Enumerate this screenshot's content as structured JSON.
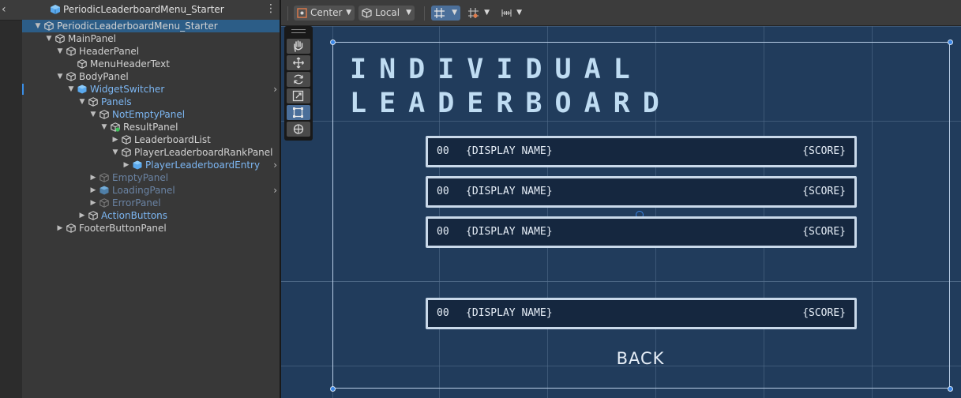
{
  "hierarchy": {
    "title": "PeriodicLeaderboardMenu_Starter",
    "back_glyph": "‹",
    "menu_glyph": "⋮",
    "rows": [
      {
        "label": "PeriodicLeaderboardMenu_Starter",
        "arrow": "▼",
        "selected": true
      },
      {
        "label": "MainPanel",
        "arrow": "▼"
      },
      {
        "label": "HeaderPanel",
        "arrow": "▼"
      },
      {
        "label": "MenuHeaderText",
        "arrow": ""
      },
      {
        "label": "BodyPanel",
        "arrow": "▼"
      },
      {
        "label": "WidgetSwitcher",
        "arrow": "▼",
        "prefab": true,
        "chevron": "›"
      },
      {
        "label": "Panels",
        "arrow": "▼",
        "prefab_child": true
      },
      {
        "label": "NotEmptyPanel",
        "arrow": "▼",
        "prefab_child": true
      },
      {
        "label": "ResultPanel",
        "arrow": "▼"
      },
      {
        "label": "LeaderboardList",
        "arrow": "▶"
      },
      {
        "label": "PlayerLeaderboardRankPanel",
        "arrow": "▼"
      },
      {
        "label": "PlayerLeaderboardEntry",
        "arrow": "▶",
        "prefab": true,
        "chevron": "›"
      },
      {
        "label": "EmptyPanel",
        "arrow": "▶",
        "inactive": true
      },
      {
        "label": "LoadingPanel",
        "arrow": "▶",
        "inactive": true,
        "prefab": true,
        "chevron": "›"
      },
      {
        "label": "ErrorPanel",
        "arrow": "▶",
        "inactive": true
      },
      {
        "label": "ActionButtons",
        "arrow": "▶",
        "prefab_child": true
      },
      {
        "label": "FooterButtonPanel",
        "arrow": "▶"
      }
    ]
  },
  "toolbar": {
    "pivot_label": "Center",
    "space_label": "Local",
    "dropdown_glyph": "▼"
  },
  "scene": {
    "title_line1": "INDIVIDUAL",
    "title_line2": "LEADERBOARD",
    "entries": [
      {
        "rank": "00",
        "name": "{DISPLAY NAME}",
        "score": "{SCORE}"
      },
      {
        "rank": "00",
        "name": "{DISPLAY NAME}",
        "score": "{SCORE}"
      },
      {
        "rank": "00",
        "name": "{DISPLAY NAME}",
        "score": "{SCORE}"
      }
    ],
    "player_entry": {
      "rank": "00",
      "name": "{DISPLAY NAME}",
      "score": "{SCORE}"
    },
    "back_label": "BACK"
  },
  "tools": [
    "hand-tool",
    "move-tool",
    "rotate-tool",
    "scale-tool",
    "rect-tool",
    "transform-tool"
  ],
  "colors": {
    "selection": "#2c5d87",
    "prefab_text": "#7cb6f2",
    "scene_bg": "#213c5c",
    "handle": "#3a86e6"
  }
}
